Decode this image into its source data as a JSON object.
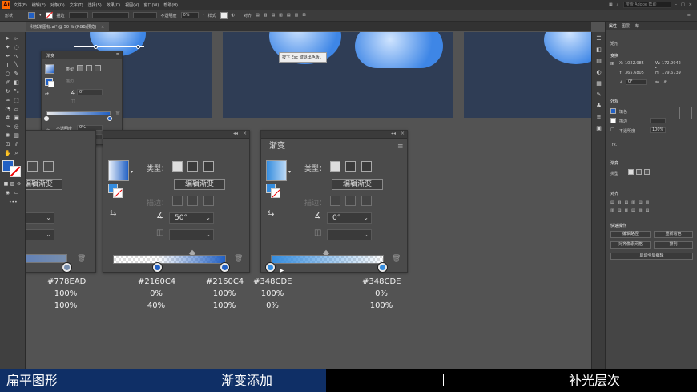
{
  "menubar": {
    "app_logo": "Ai",
    "items": [
      "文件(F)",
      "编辑(E)",
      "对象(O)",
      "文字(T)",
      "选择(S)",
      "效果(C)",
      "视图(V)",
      "窗口(W)",
      "帮助(H)"
    ],
    "search_placeholder": "搜索 Adobe 帮助"
  },
  "controlbar": {
    "label": "形状",
    "stroke_label": "描边",
    "opacity_label": "不透明度",
    "opacity_value": "0%",
    "style_label": "样式",
    "align_label": "对齐"
  },
  "doc_tab": {
    "title": "科技渐图标.ai* @ 50 % (RGB/预览)",
    "close": "×"
  },
  "canvas": {
    "tooltip": "按下 Esc 键退出色板。",
    "small_panel": {
      "title": "渐变",
      "type_label": "类型",
      "stroke_label": "描边",
      "angle_value": "0°",
      "opacity_label": "不透明度",
      "opacity_value": "0%",
      "position_label": "位置",
      "position_value": "0%"
    },
    "panel_a": {
      "edit_label": "编辑渐变",
      "angle_value": ""
    },
    "panel_b": {
      "type_label": "类型：",
      "edit_label": "编辑渐变",
      "stroke_label": "描边：",
      "angle_value": "50°"
    },
    "panel_c": {
      "tab": "渐变",
      "type_label": "类型：",
      "edit_label": "编辑渐变",
      "stroke_label": "描边：",
      "angle_value": "0°"
    },
    "annotations": [
      {
        "color": "#778EAD",
        "opacity": "100%",
        "position": "100%"
      },
      {
        "color": "#2160C4",
        "opacity": "0%",
        "position": "40%"
      },
      {
        "color": "#2160C4",
        "opacity": "100%",
        "position": "100%"
      },
      {
        "color": "#348CDE",
        "opacity": "100%",
        "position": "0%"
      },
      {
        "color": "#348CDE",
        "opacity": "0%",
        "position": "100%"
      }
    ]
  },
  "right_panel": {
    "tabs": [
      "属性",
      "图层",
      "库"
    ],
    "section_shape": "矩形",
    "transform_label": "变换",
    "x_label": "X:",
    "x_value": "1022.985",
    "y_label": "Y:",
    "y_value": "365.6805",
    "w_label": "W:",
    "w_value": "172.9942",
    "h_label": "H:",
    "h_value": "179.6739",
    "angle_value": "0°",
    "appearance_label": "外观",
    "fill_label": "填色",
    "stroke_label": "描边",
    "opacity_label": "不透明度",
    "opacity_value": "100%",
    "fx_label": "fx.",
    "type_label": "渐变",
    "type_row": "类型",
    "align_label": "对齐",
    "quick_actions_label": "快速操作",
    "btn_edit": "编辑路径",
    "btn_recolor": "重新着色",
    "btn_pixel": "对齐像素网格",
    "btn_arrange": "排列",
    "btn_global": "启动全局编辑"
  },
  "bottom_bar": {
    "seg1": "扁平图形",
    "seg2": "渐变添加",
    "seg3": "补光层次"
  },
  "colors": {
    "bottom_active": "#0f2f66",
    "gradient_blue": "#2160C4",
    "gradient_gray": "#778EAD",
    "gradient_light": "#348CDE"
  }
}
